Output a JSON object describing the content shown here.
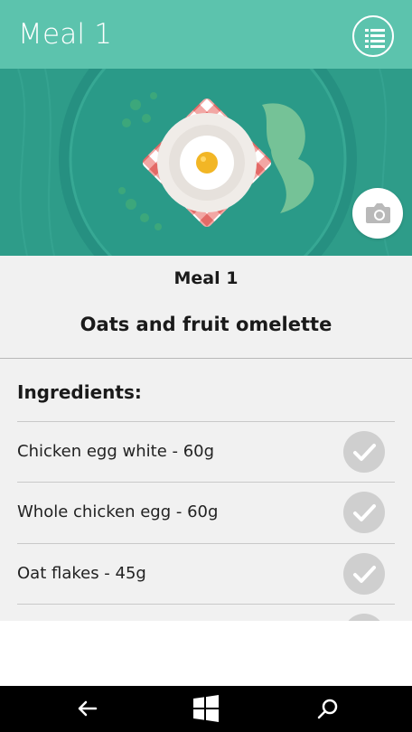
{
  "header": {
    "title": "Meal 1",
    "menu_icon": "list-icon"
  },
  "hero": {
    "image": "plate-with-fried-egg-illustration",
    "camera_icon": "camera-icon"
  },
  "meal": {
    "label": "Meal 1",
    "name": "Oats and fruit omelette"
  },
  "ingredients": {
    "heading": "Ingredients:",
    "items": [
      {
        "name": "Chicken egg white - 60g",
        "checked": true
      },
      {
        "name": "Whole chicken egg - 60g",
        "checked": true
      },
      {
        "name": "Oat flakes - 45g",
        "checked": true
      }
    ]
  },
  "nav": {
    "back_icon": "back-arrow-icon",
    "home_icon": "windows-icon",
    "search_icon": "search-icon"
  },
  "colors": {
    "accent": "#5cc3ad",
    "check_bg": "#cfcfcf",
    "panel_bg": "#f1f1f1"
  }
}
